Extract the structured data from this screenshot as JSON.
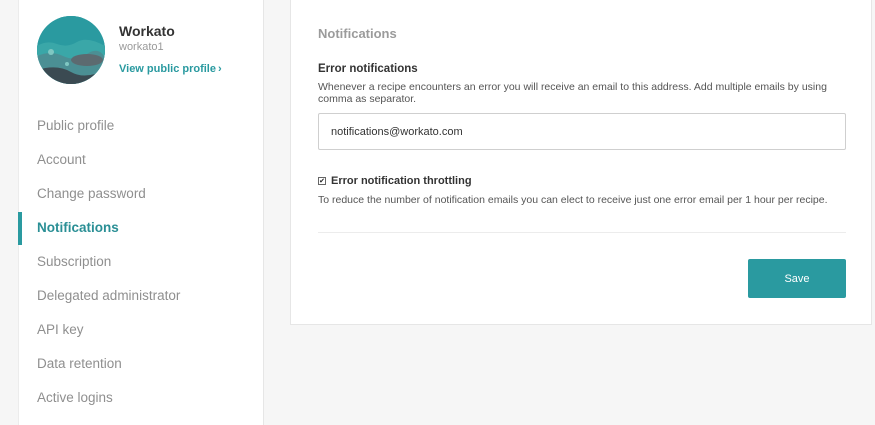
{
  "colors": {
    "accent": "#2a9aa0",
    "accent_text": "#2a8f95",
    "muted_text": "#8f8f8f"
  },
  "profile": {
    "name": "Workato",
    "handle": "workato1",
    "link_label": "View public profile",
    "link_icon": "chevron-right-icon"
  },
  "sidebar": {
    "items": [
      {
        "label": "Public profile",
        "active": false
      },
      {
        "label": "Account",
        "active": false
      },
      {
        "label": "Change password",
        "active": false
      },
      {
        "label": "Notifications",
        "active": true
      },
      {
        "label": "Subscription",
        "active": false
      },
      {
        "label": "Delegated administrator",
        "active": false
      },
      {
        "label": "API key",
        "active": false
      },
      {
        "label": "Data retention",
        "active": false
      },
      {
        "label": "Active logins",
        "active": false
      }
    ]
  },
  "main": {
    "title": "Notifications",
    "error_notifications": {
      "label": "Error notifications",
      "description": "Whenever a recipe encounters an error you will receive an email to this address. Add multiple emails by using comma as separator.",
      "value": "notifications@workato.com"
    },
    "throttling": {
      "label": "Error notification throttling",
      "checked": true,
      "description": "To reduce the number of notification emails you can elect to receive just one error email per 1 hour per recipe."
    },
    "save_label": "Save"
  }
}
